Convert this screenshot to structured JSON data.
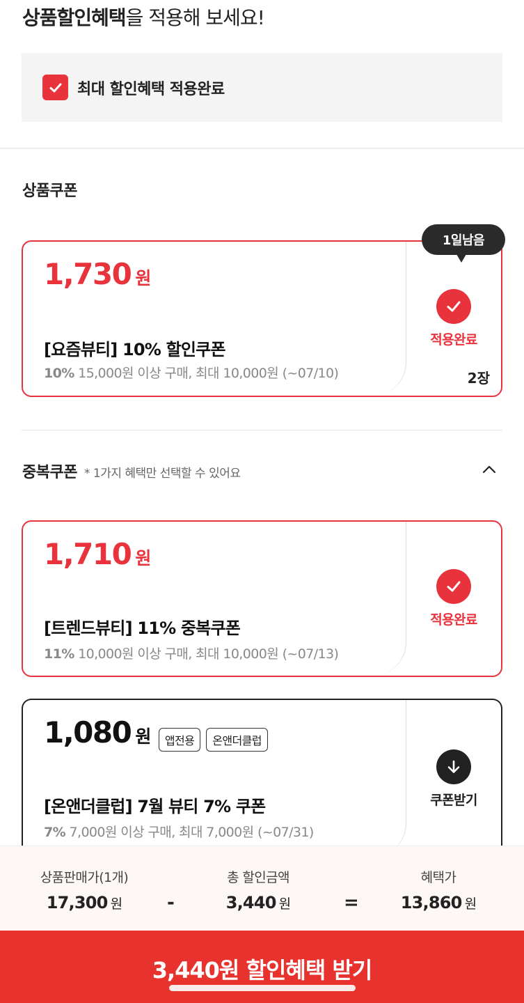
{
  "header": {
    "title_bold": "상품할인혜택",
    "title_rest": "을 적용해 보세요!"
  },
  "max_discount": {
    "label": "최대 할인혜택 적용완료",
    "checked": true
  },
  "product_coupons": {
    "title": "상품쿠폰",
    "items": [
      {
        "amount": "1,730",
        "unit": "원",
        "name": "[요즘뷰티] 10% 할인쿠폰",
        "percent": "10%",
        "condition": "15,000원 이상 구매, 최대 10,000원  (~07/10)",
        "status": "적용완료",
        "quantity": "2장",
        "badge": "1일남음"
      }
    ]
  },
  "stack_coupons": {
    "title": "중복쿠폰",
    "note": "* 1가지 혜택만 선택할 수 있어요",
    "items": [
      {
        "amount": "1,710",
        "unit": "원",
        "name": "[트렌드뷰티] 11% 중복쿠폰",
        "percent": "11%",
        "condition": "10,000원 이상 구매, 최대 10,000원  (~07/13)",
        "status": "적용완료"
      },
      {
        "amount": "1,080",
        "unit": "원",
        "tags": [
          "앱전용",
          "온앤더클럽"
        ],
        "name": "[온앤더클럽] 7월 뷰티 7% 쿠폰",
        "percent": "7%",
        "condition": "7,000원 이상 구매, 최대 7,000원  (~07/31)",
        "status": "쿠폰받기"
      }
    ]
  },
  "summary": {
    "price_label": "상품판매가(1개)",
    "price_value": "17,300",
    "discount_label": "총 할인금액",
    "discount_value": "3,440",
    "final_label": "혜택가",
    "final_value": "13,860",
    "unit": "원",
    "minus": "-",
    "equals": "="
  },
  "cta": {
    "label": "3,440원 할인혜택 받기"
  },
  "colors": {
    "accent": "#e8323c",
    "cta": "#e8322e",
    "dark": "#222222"
  }
}
